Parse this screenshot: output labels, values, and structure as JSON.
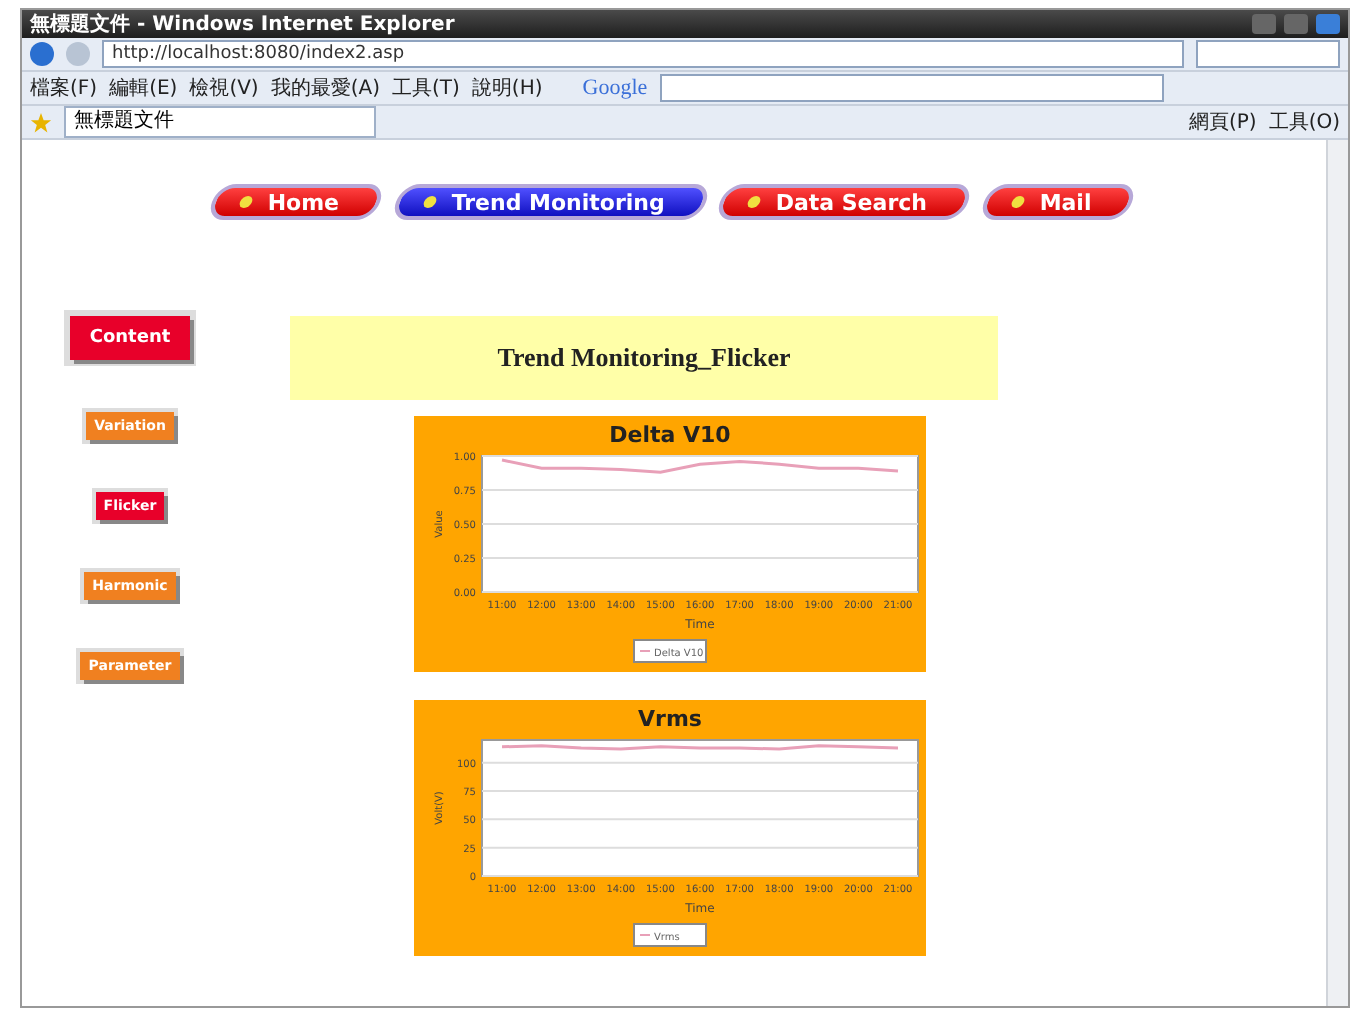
{
  "window": {
    "title": "無標題文件 - Windows Internet Explorer"
  },
  "address_bar": {
    "url": "http://localhost:8080/index2.asp"
  },
  "menu_bar": [
    "檔案(F)",
    "編輯(E)",
    "檢視(V)",
    "我的最愛(A)",
    "工具(T)",
    "說明(H)"
  ],
  "google_bar": {
    "logo": "Google"
  },
  "browser_tabs": [
    {
      "label": "無標題文件",
      "selected": true
    }
  ],
  "command_bar": [
    "網頁(P)",
    "工具(O)"
  ],
  "nav": [
    {
      "label": "Home",
      "selected": false
    },
    {
      "label": "Trend Monitoring",
      "selected": true
    },
    {
      "label": "Data Search",
      "selected": false
    },
    {
      "label": "Mail",
      "selected": false
    }
  ],
  "side_menu": [
    {
      "label": "Content",
      "kind": "header"
    },
    {
      "label": "Variation",
      "kind": "item",
      "selected": false
    },
    {
      "label": "Flicker",
      "kind": "item",
      "selected": true
    },
    {
      "label": "Harmonic",
      "kind": "item",
      "selected": false
    },
    {
      "label": "Parameter",
      "kind": "item",
      "selected": false
    }
  ],
  "page_title": "Trend Monitoring_Flicker",
  "charts": [
    {
      "chart_data": {
        "type": "line",
        "grid": true,
        "title": "Delta  V10",
        "xlabel": "Time",
        "ylabel": "Value",
        "categories": [
          "11:00",
          "12:00",
          "13:00",
          "14:00",
          "15:00",
          "16:00",
          "17:00",
          "18:00",
          "19:00",
          "20:00",
          "21:00"
        ],
        "ylim": [
          0,
          1
        ],
        "yticks": [
          {
            "value": 0,
            "label": "0.00"
          },
          {
            "value": 0.25,
            "label": "0.25"
          },
          {
            "value": 0.5,
            "label": "0.50"
          },
          {
            "value": 0.75,
            "label": "0.75"
          },
          {
            "value": 1,
            "label": "1.00"
          }
        ],
        "series": [
          {
            "name": "Delta V10",
            "color": "#e8a0b8",
            "values": [
              0.97,
              0.91,
              0.91,
              0.9,
              0.88,
              0.94,
              0.96,
              0.94,
              0.91,
              0.91,
              0.89
            ]
          }
        ]
      }
    },
    {
      "chart_data": {
        "type": "line",
        "grid": true,
        "title": "Vrms",
        "xlabel": "Time",
        "ylabel": "Volt(V)",
        "categories": [
          "11:00",
          "12:00",
          "13:00",
          "14:00",
          "15:00",
          "16:00",
          "17:00",
          "18:00",
          "19:00",
          "20:00",
          "21:00"
        ],
        "ylim": [
          0,
          120
        ],
        "yticks": [
          {
            "value": 0,
            "label": "0"
          },
          {
            "value": 25,
            "label": "25"
          },
          {
            "value": 50,
            "label": "50"
          },
          {
            "value": 75,
            "label": "75"
          },
          {
            "value": 100,
            "label": "100"
          }
        ],
        "series": [
          {
            "name": "Vrms",
            "color": "#e8a0b8",
            "values": [
              114,
              115,
              113,
              112,
              114,
              113,
              113,
              112,
              115,
              114,
              113
            ]
          }
        ]
      }
    }
  ]
}
